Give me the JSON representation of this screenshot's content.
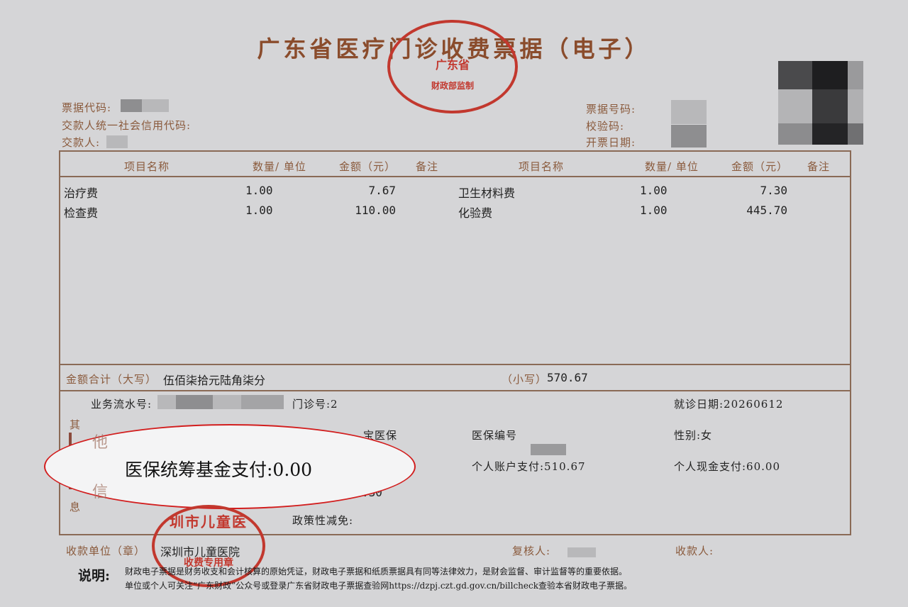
{
  "title": "广东省医疗门诊收费票据（电子）",
  "header": {
    "code_label": "票据代码:",
    "credit_label": "交款人统一社会信用代码:",
    "payer_label": "交款人:",
    "number_label": "票据号码:",
    "check_label": "校验码:",
    "date_label": "开票日期:"
  },
  "table": {
    "headers": [
      "项目名称",
      "数量/ 单位",
      "金额（元）",
      "备注",
      "项目名称",
      "数量/ 单位",
      "金额（元）",
      "备注"
    ],
    "rows": [
      {
        "name1": "治疗费",
        "qty1": "1.00",
        "amt1": "7.67",
        "name2": "卫生材料费",
        "qty2": "1.00",
        "amt2": "7.30"
      },
      {
        "name1": "检查费",
        "qty1": "1.00",
        "amt1": "110.00",
        "name2": "化验费",
        "qty2": "1.00",
        "amt2": "445.70"
      }
    ]
  },
  "total": {
    "upper_label": "金额合计（大写）",
    "upper_value": "伍佰柒拾元陆角柒分",
    "lower_label": "（小写）",
    "lower_value": "570.67"
  },
  "other": {
    "side_label": [
      "其",
      "他",
      "信",
      "息"
    ],
    "serial_label": "业务流水号:",
    "clinic_label": "门诊号:2",
    "visit_date": "就诊日期:20260612",
    "partial_text": "宝医保",
    "insurance_no_label": "医保编号",
    "gender": "性别:女",
    "fund_pay": "医保统筹基金支付:0.00",
    "account_pay": "个人账户支付:510.67",
    "cash_pay": "个人现金支付:60.00",
    "partial_amount": ".30",
    "policy_label": "政策性减免:"
  },
  "footer": {
    "payee_label": "收款单位（章）",
    "payee_value": "深圳市儿童医院",
    "reviewer_label": "复核人:",
    "collector_label": "收款人:",
    "note_title": "说明:",
    "note_line1": "财政电子票据是财务收支和会计核算的原始凭证，财政电子票据和纸质票据具有同等法律效力，是财会监督、审计监督等的重要依据。",
    "note_line2": "单位或个人可关注“广东财政”公众号或登录广东省财政电子票据查验网https://dzpj.czt.gd.gov.cn/billcheck查验本省财政电子票据。"
  },
  "stamps": {
    "top_text": "广东省",
    "top_bottom": "财政部监制",
    "bottom_text": "圳市儿童医",
    "bottom_sub": "收费专用章"
  },
  "colors": {
    "seal": "#c2382e",
    "frame": "#8a6a56",
    "label": "#8a5a3c",
    "highlight": "#d21e1e"
  }
}
